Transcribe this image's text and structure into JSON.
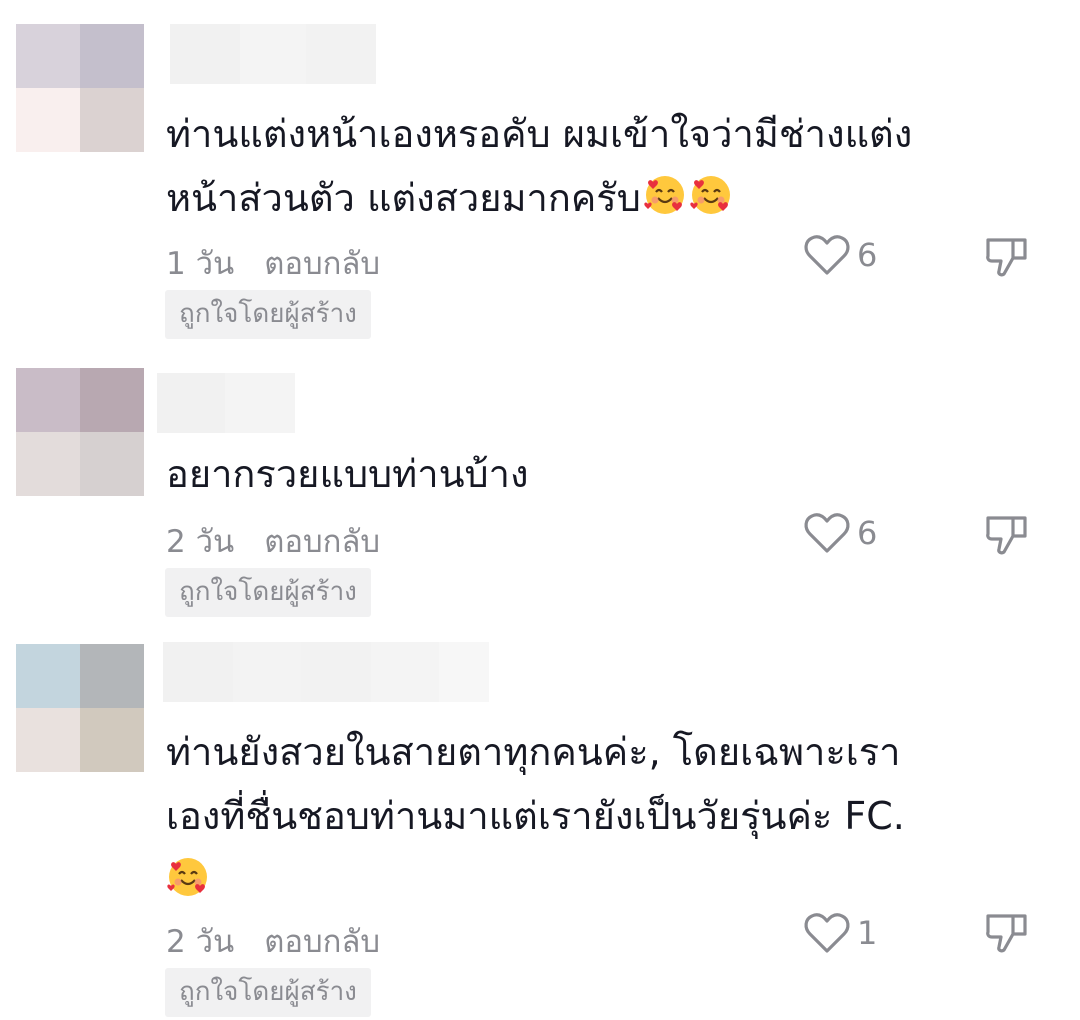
{
  "comments": [
    {
      "text_lines": [
        "ท่านแต่งหน้าเองหรอคับ ผมเข้าใจว่ามีช่างแต่ง",
        "หน้าส่วนตัว แต่งสวยมากครับ"
      ],
      "emoji": "smiling-face-with-hearts",
      "emoji_count": 2,
      "time": "1 วัน",
      "reply_label": "ตอบกลับ",
      "likes": "6",
      "badge": "ถูกใจโดยผู้สร้าง",
      "avatar_colors": [
        "#d8d2db",
        "#c4bfcc",
        "#f9efee",
        "#dbd2d1"
      ]
    },
    {
      "text_lines": [
        "อยากรวยแบบท่านบ้าง"
      ],
      "emoji": "",
      "emoji_count": 0,
      "time": "2 วัน",
      "reply_label": "ตอบกลับ",
      "likes": "6",
      "badge": "ถูกใจโดยผู้สร้าง",
      "avatar_colors": [
        "#c9bcc7",
        "#b8a8b1",
        "#e3dcdb",
        "#d6d0d0"
      ]
    },
    {
      "text_lines": [
        "ท่านยังสวยในสายตาทุกคนค่ะ, โดยเฉพาะเรา",
        "เองที่ชื่นชอบท่านมาแต่เรายังเป็นวัยรุ่นค่ะ  FC."
      ],
      "emoji": "smiling-face-with-hearts",
      "emoji_count": 1,
      "time": "2 วัน",
      "reply_label": "ตอบกลับ",
      "likes": "1",
      "badge": "ถูกใจโดยผู้สร้าง",
      "avatar_colors": [
        "#c3d5de",
        "#b3b6b9",
        "#e9e1de",
        "#d1c9be"
      ]
    }
  ],
  "colors": {
    "text": "#161823",
    "muted": "#8a8b91",
    "badge_bg": "#f1f1f2"
  },
  "icons": {
    "like": "heart-outline-icon",
    "dislike": "thumbs-down-outline-icon"
  }
}
